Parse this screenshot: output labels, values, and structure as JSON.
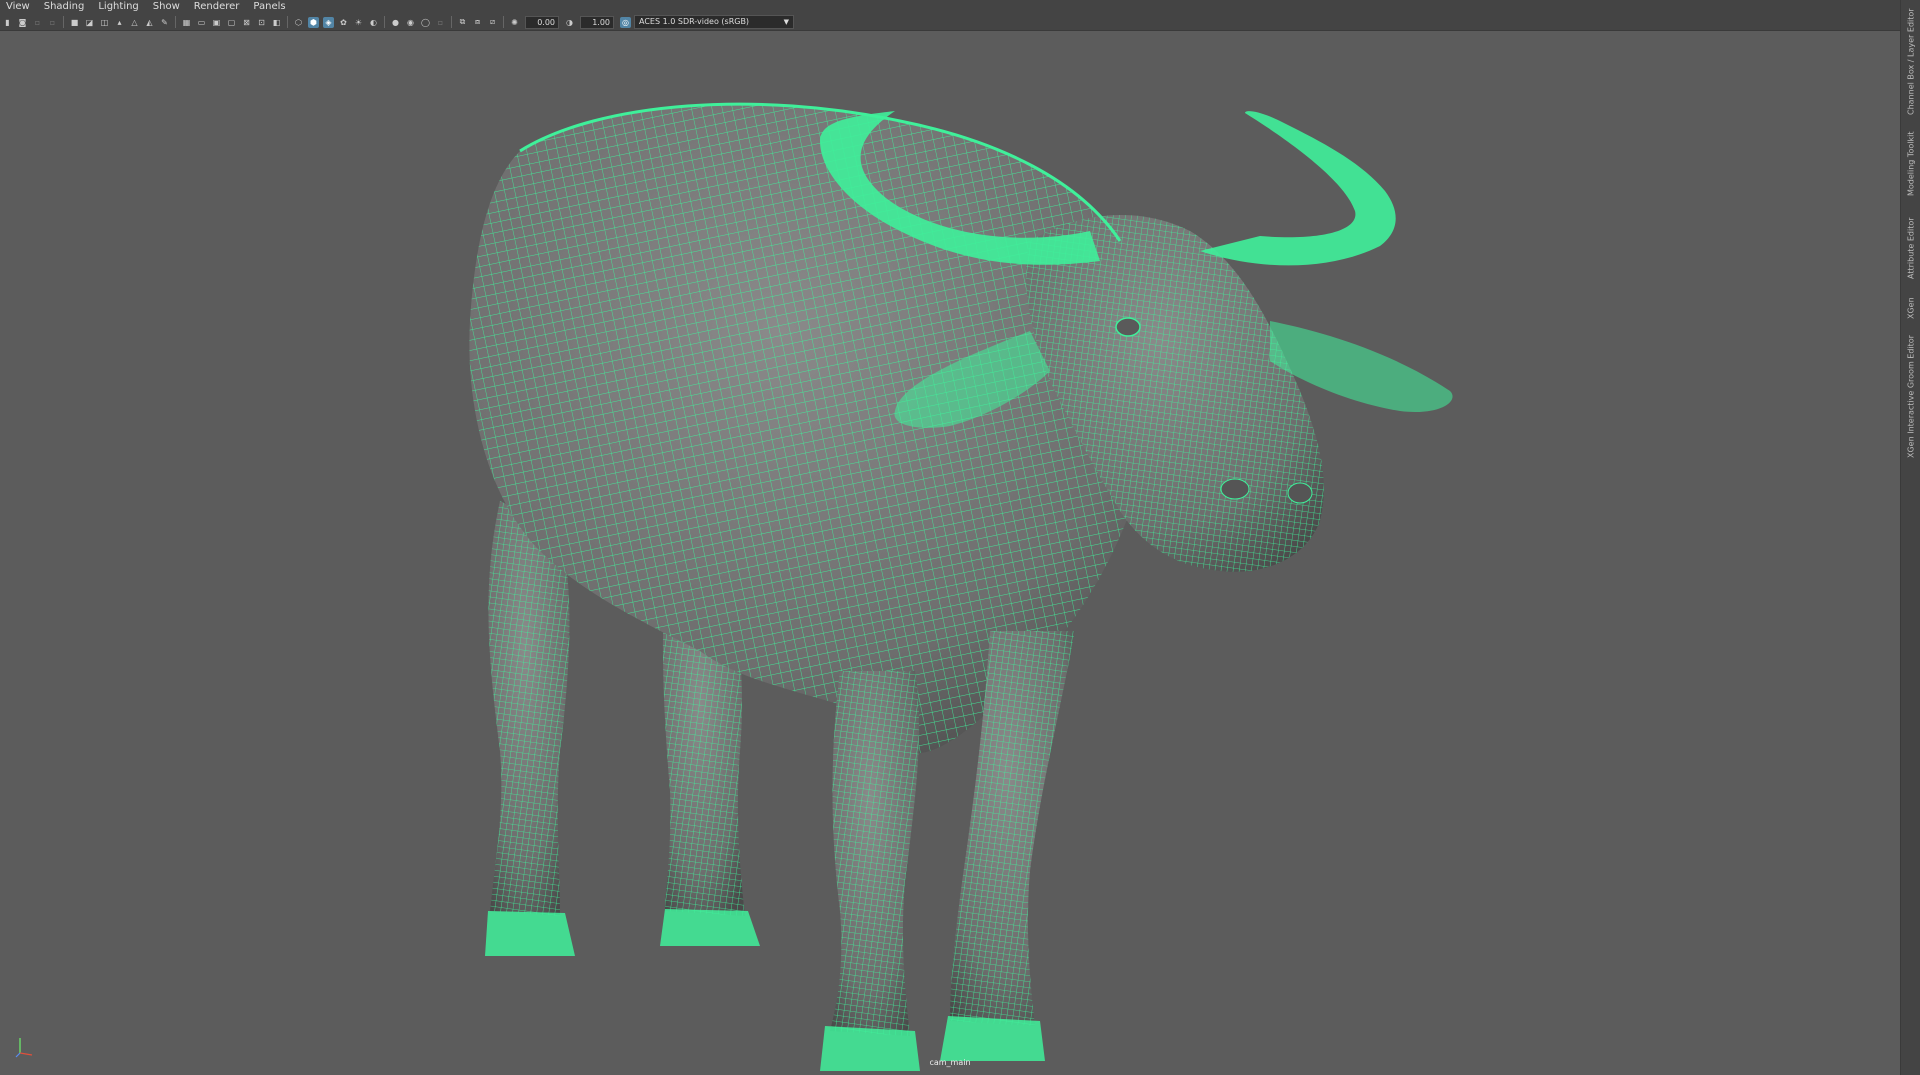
{
  "menu": [
    "View",
    "Shading",
    "Lighting",
    "Show",
    "Renderer",
    "Panels"
  ],
  "toolbar": {
    "exposure_value": "0.00",
    "gamma_value": "1.00",
    "color_space": "ACES 1.0 SDR-video (sRGB)"
  },
  "side_tabs": [
    "Channel Box / Layer Editor",
    "Modeling Toolkit",
    "Attribute Editor",
    "XGen",
    "XGen Interactive Groom Editor"
  ],
  "viewport": {
    "camera_label": "cam_main",
    "object": "water-buffalo-wireframe-mesh",
    "wire_color": "#3ff09a",
    "shade_color": "#7d7d7d",
    "background_color": "#5c5c5c"
  },
  "icons": [
    "camera-icon",
    "grid-icon",
    "wireframe-icon",
    "smooth-shade-icon",
    "light-icon",
    "exposure-icon",
    "gamma-icon",
    "color-management-icon",
    "axis-gizmo-icon"
  ]
}
